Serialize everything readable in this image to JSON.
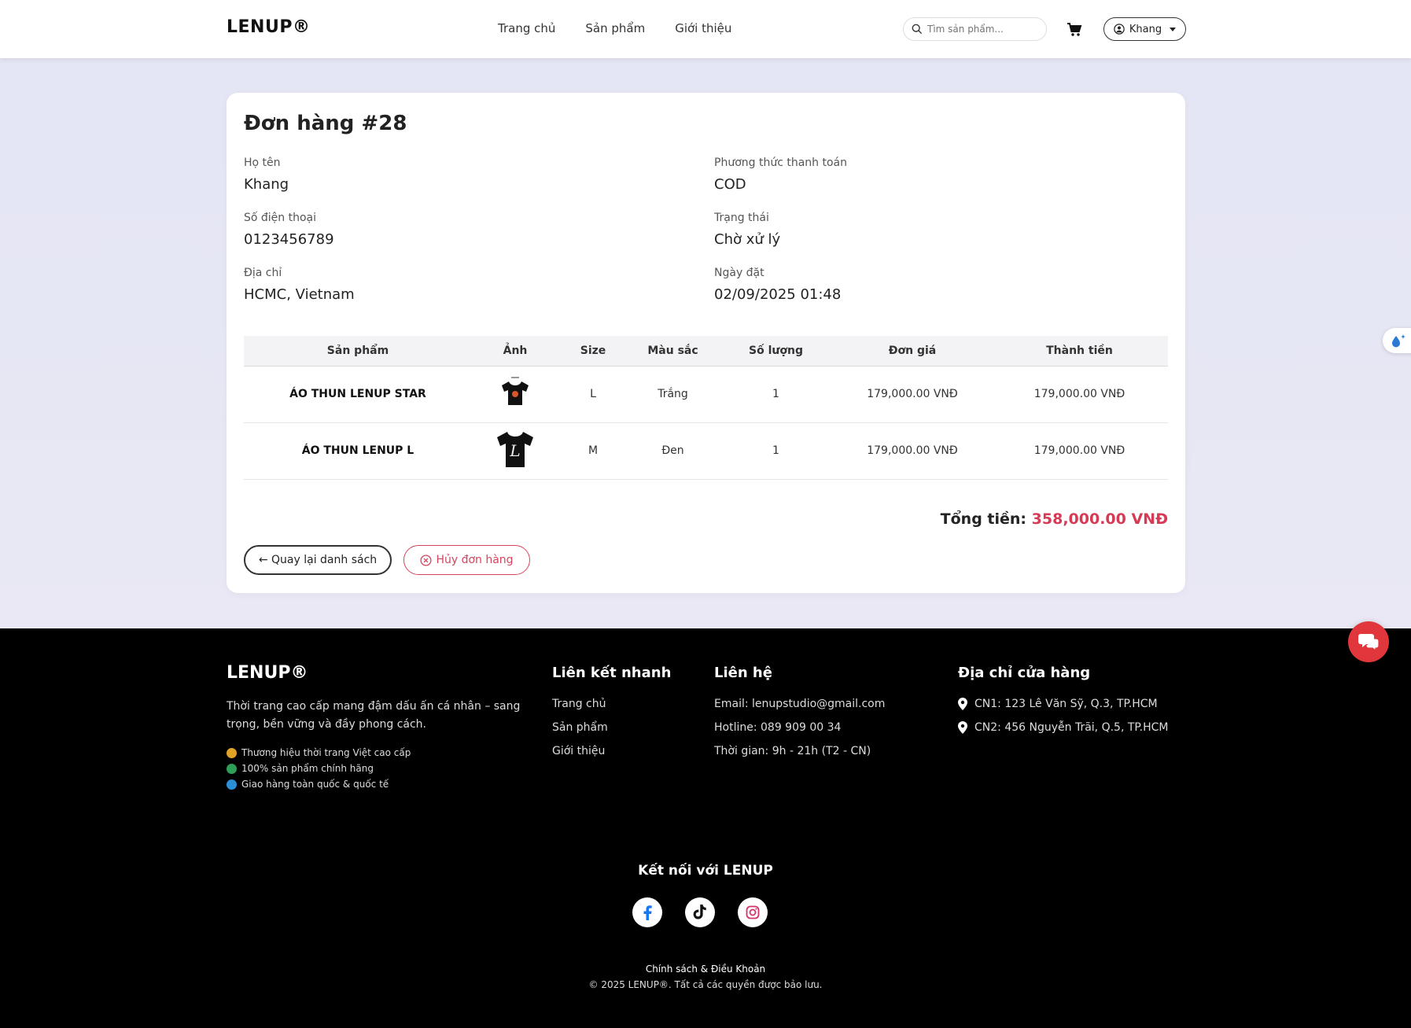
{
  "navbar": {
    "brand": "LENUP®",
    "links": [
      "Trang chủ",
      "Sản phẩm",
      "Giới thiệu"
    ],
    "search_placeholder": "Tìm sản phẩm...",
    "user_name": "Khang"
  },
  "order": {
    "title": "Đơn hàng #28",
    "fields": {
      "name_label": "Họ tên",
      "name_value": "Khang",
      "phone_label": "Số điện thoại",
      "phone_value": "0123456789",
      "address_label": "Địa chỉ",
      "address_value": "HCMC, Vietnam",
      "payment_label": "Phương thức thanh toán",
      "payment_value": "COD",
      "status_label": "Trạng thái",
      "status_value": "Chờ xử lý",
      "date_label": "Ngày đặt",
      "date_value": "02/09/2025 01:48"
    },
    "table": {
      "headers": [
        "Sản phẩm",
        "Ảnh",
        "Size",
        "Màu sắc",
        "Số lượng",
        "Đơn giá",
        "Thành tiền"
      ],
      "rows": [
        {
          "product": "ÁO THUN LENUP STAR",
          "size": "L",
          "color": "Trắng",
          "qty": "1",
          "unit_price": "179,000.00 VNĐ",
          "subtotal": "179,000.00 VNĐ"
        },
        {
          "product": "ÁO THUN LENUP L",
          "size": "M",
          "color": "Đen",
          "qty": "1",
          "unit_price": "179,000.00 VNĐ",
          "subtotal": "179,000.00 VNĐ"
        }
      ]
    },
    "total_label": "Tổng tiền:",
    "total_value": "358,000.00 VNĐ",
    "back_button": "← Quay lại danh sách",
    "cancel_button": "Hủy đơn hàng"
  },
  "footer": {
    "brand": "LENUP®",
    "description": "Thời trang cao cấp mang đậm dấu ấn cá nhân – sang trọng, bền vững và đầy phong cách.",
    "perks": [
      "Thương hiệu thời trang Việt cao cấp",
      "100% sản phẩm chính hãng",
      "Giao hàng toàn quốc & quốc tế"
    ],
    "quick_links_title": "Liên kết nhanh",
    "quick_links": [
      "Trang chủ",
      "Sản phẩm",
      "Giới thiệu"
    ],
    "contact_title": "Liên hệ",
    "contact": [
      "Email: lenupstudio@gmail.com",
      "Hotline: 089 909 00 34",
      "Thời gian: 9h - 21h (T2 - CN)"
    ],
    "stores_title": "Địa chỉ cửa hàng",
    "stores": [
      "CN1: 123 Lê Văn Sỹ, Q.3, TP.HCM",
      "CN2: 456 Nguyễn Trãi, Q.5, TP.HCM"
    ],
    "connect_title": "Kết nối với LENUP",
    "policy": "Chính sách & Điều Khoản",
    "copyright": "© 2025 LENUP®. Tất cả các quyền được bảo lưu."
  },
  "colors": {
    "accent": "#d63a55",
    "footer_bg": "#000000",
    "chat": "#e1373c"
  }
}
